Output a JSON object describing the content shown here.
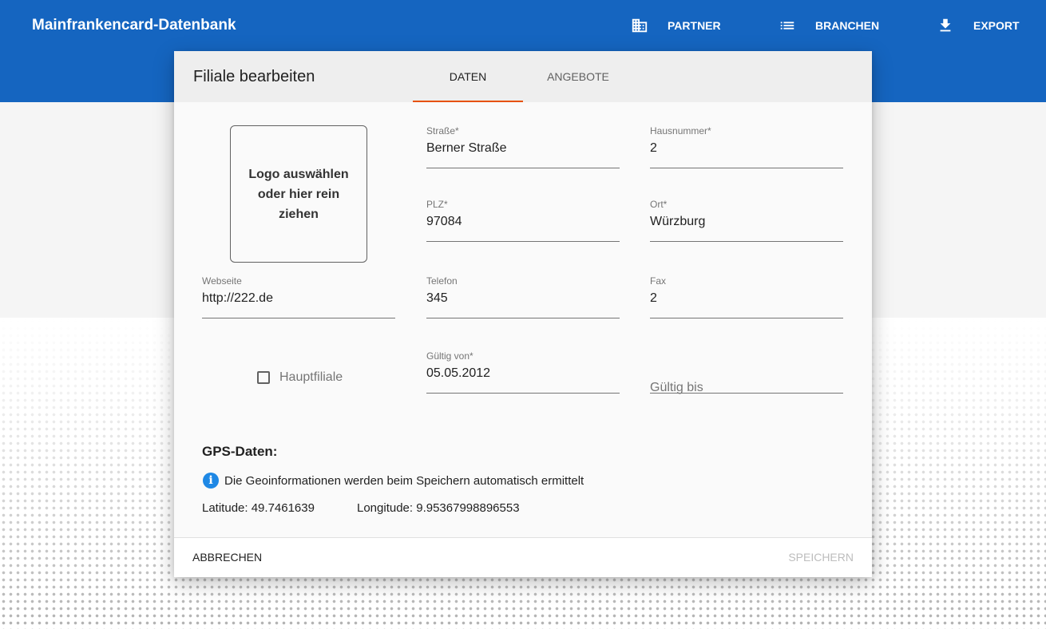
{
  "app": {
    "title": "Mainfrankencard-Datenbank"
  },
  "nav": {
    "partner": {
      "label": "PARTNER",
      "icon": "building-icon"
    },
    "branchen": {
      "label": "BRANCHEN",
      "icon": "list-icon"
    },
    "export": {
      "label": "EXPORT",
      "icon": "download-icon"
    }
  },
  "dialog": {
    "title": "Filiale bearbeiten",
    "tabs": [
      {
        "label": "DATEN",
        "active": true
      },
      {
        "label": "ANGEBOTE",
        "active": false
      }
    ],
    "logo_upload": {
      "label": "Logo auswählen oder hier rein ziehen"
    },
    "fields": {
      "strasse": {
        "label": "Straße*",
        "value": "Berner Straße"
      },
      "hausnummer": {
        "label": "Hausnummer*",
        "value": "2"
      },
      "plz": {
        "label": "PLZ*",
        "value": "97084"
      },
      "ort": {
        "label": "Ort*",
        "value": "Würzburg"
      },
      "webseite": {
        "label": "Webseite",
        "value": "http://222.de"
      },
      "telefon": {
        "label": "Telefon",
        "value": "345"
      },
      "fax": {
        "label": "Fax",
        "value": "2"
      },
      "gueltig_von": {
        "label": "Gültig von*",
        "value": "05.05.2012"
      },
      "gueltig_bis": {
        "placeholder": "Gültig bis"
      }
    },
    "hauptfiliale": {
      "label": "Hauptfiliale",
      "checked": false
    },
    "gps": {
      "title": "GPS-Daten:",
      "info": "Die Geoinformationen werden beim Speichern automatisch ermittelt",
      "latitude": "Latitude: 49.7461639",
      "longitude": "Longitude: 9.95367998896553"
    },
    "footer": {
      "cancel": "ABBRECHEN",
      "save": "SPEICHERN"
    }
  },
  "colors": {
    "primary": "#1565c0",
    "tab_indicator": "#e65100",
    "info_icon": "#1e88e5"
  }
}
